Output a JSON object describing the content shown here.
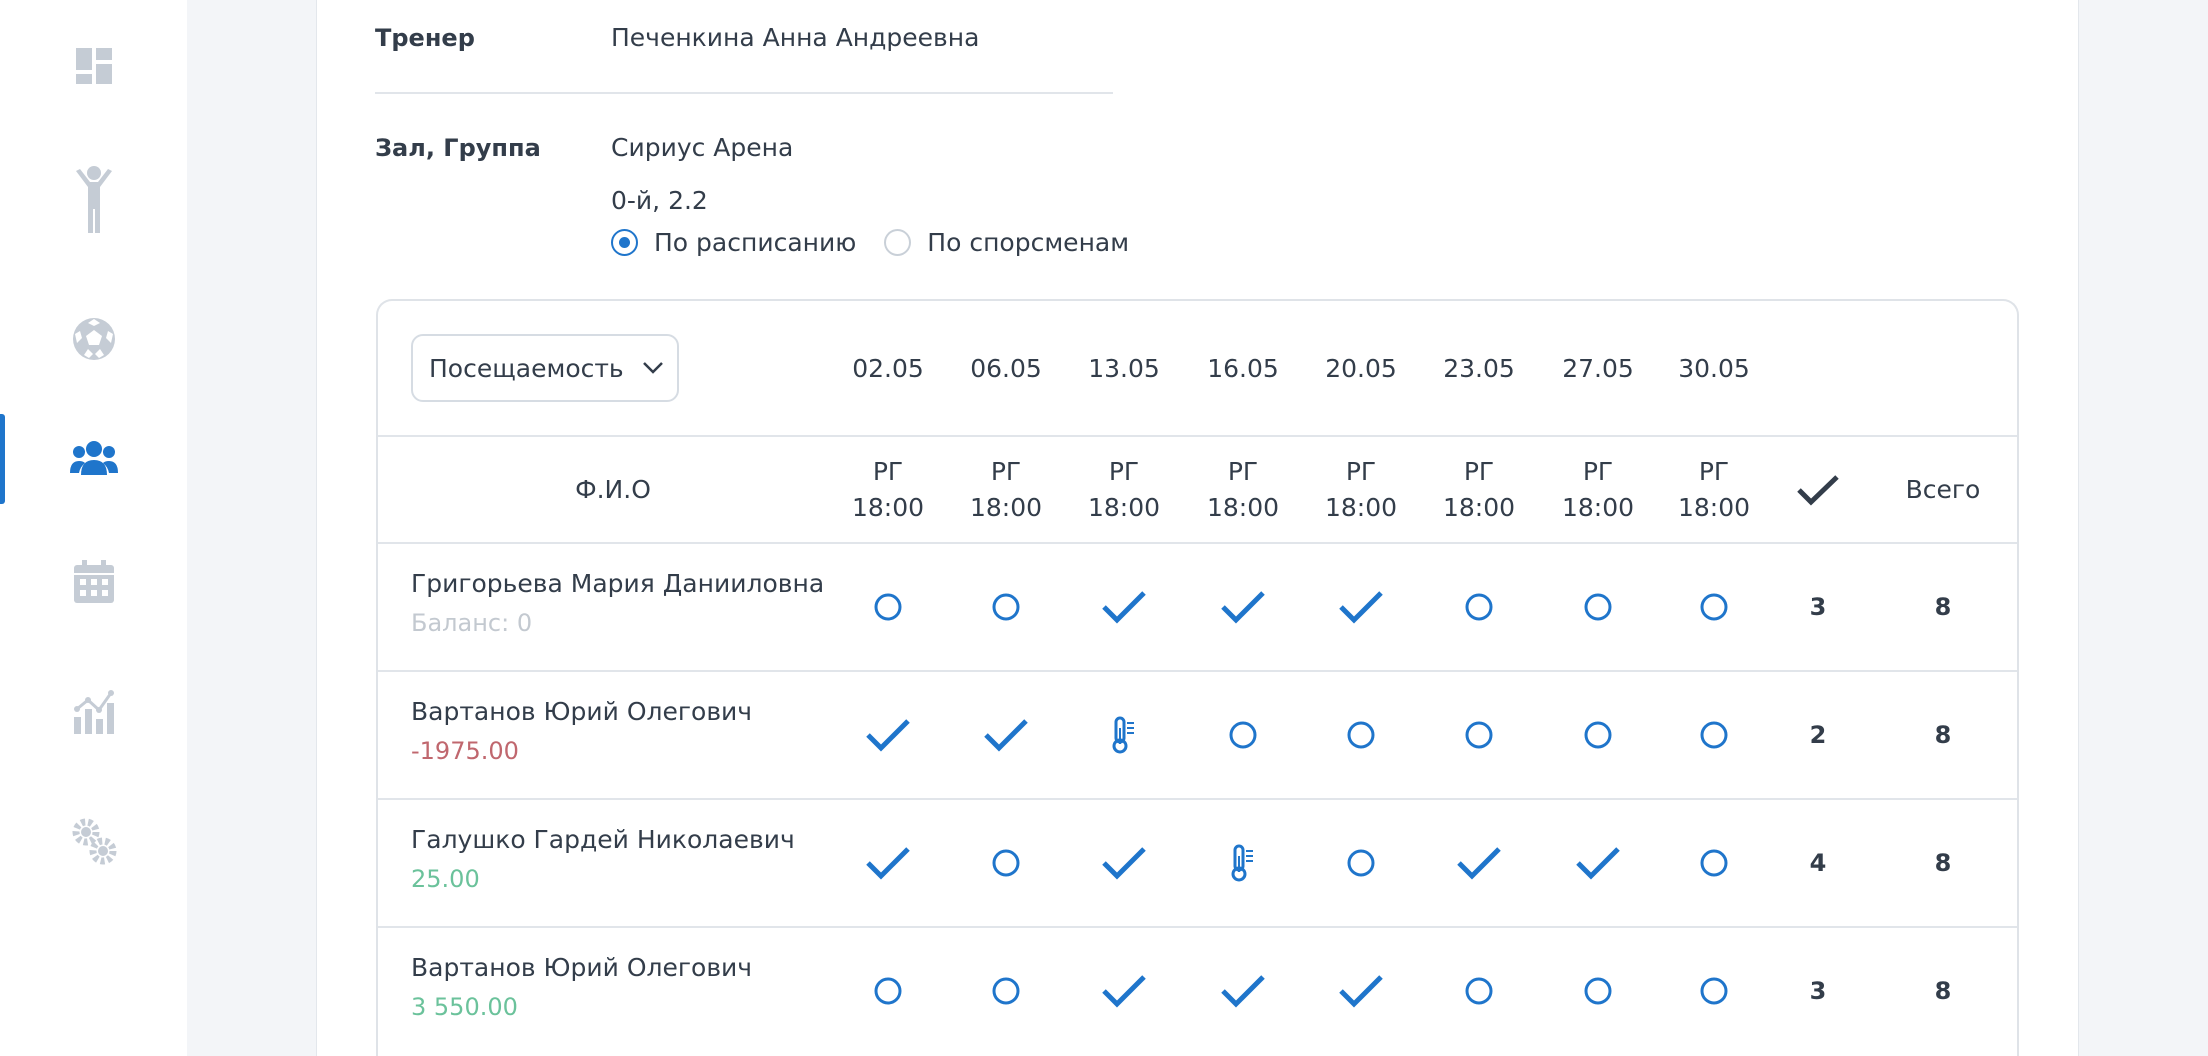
{
  "colors": {
    "accent": "#1f75cb",
    "sidebar_icon": "#c5ccd5",
    "balance_zero": "#c3c9d0",
    "balance_negative": "#c0676e",
    "balance_positive": "#6bc29b"
  },
  "sidebar": {
    "items": [
      {
        "icon": "dashboard-icon",
        "active": false
      },
      {
        "icon": "athlete-icon",
        "active": false
      },
      {
        "icon": "soccer-ball-icon",
        "active": false
      },
      {
        "icon": "group-icon",
        "active": true
      },
      {
        "icon": "calendar-icon",
        "active": false
      },
      {
        "icon": "analytics-icon",
        "active": false
      },
      {
        "icon": "settings-icon",
        "active": false
      }
    ]
  },
  "trainer": {
    "label": "Тренер",
    "value": "Печенкина Анна Андреевна"
  },
  "hall": {
    "label": "Зал, Группа",
    "value": "Сириус Арена",
    "group": "0-й, 2.2"
  },
  "view_mode": {
    "options": [
      "По расписанию",
      "По спорсменам"
    ],
    "selected": 0
  },
  "table": {
    "mode_dropdown": "Посещаемость",
    "dates": [
      "02.05",
      "06.05",
      "13.05",
      "16.05",
      "20.05",
      "23.05",
      "27.05",
      "30.05"
    ],
    "slots": [
      {
        "type": "РГ",
        "time": "18:00"
      },
      {
        "type": "РГ",
        "time": "18:00"
      },
      {
        "type": "РГ",
        "time": "18:00"
      },
      {
        "type": "РГ",
        "time": "18:00"
      },
      {
        "type": "РГ",
        "time": "18:00"
      },
      {
        "type": "РГ",
        "time": "18:00"
      },
      {
        "type": "РГ",
        "time": "18:00"
      },
      {
        "type": "РГ",
        "time": "18:00"
      }
    ],
    "name_header": "Ф.И.О",
    "attended_header_icon": "check-icon",
    "total_header": "Всего",
    "rows": [
      {
        "name": "Григорьева Мария Данииловна",
        "balance": "Баланс: 0",
        "balance_kind": "zero",
        "marks": [
          "empty",
          "empty",
          "check",
          "check",
          "check",
          "empty",
          "empty",
          "empty"
        ],
        "attended": "3",
        "total": "8"
      },
      {
        "name": "Вартанов Юрий Олегович",
        "balance": "-1975.00",
        "balance_kind": "negative",
        "marks": [
          "check",
          "check",
          "sick",
          "empty",
          "empty",
          "empty",
          "empty",
          "empty"
        ],
        "attended": "2",
        "total": "8"
      },
      {
        "name": "Галушко Гардей Николаевич",
        "balance": "25.00",
        "balance_kind": "positive",
        "marks": [
          "check",
          "empty",
          "check",
          "sick",
          "empty",
          "check",
          "check",
          "empty"
        ],
        "attended": "4",
        "total": "8"
      },
      {
        "name": "Вартанов Юрий Олегович",
        "balance": "3 550.00",
        "balance_kind": "positive",
        "marks": [
          "empty",
          "empty",
          "check",
          "check",
          "check",
          "empty",
          "empty",
          "empty"
        ],
        "attended": "3",
        "total": "8"
      }
    ]
  }
}
